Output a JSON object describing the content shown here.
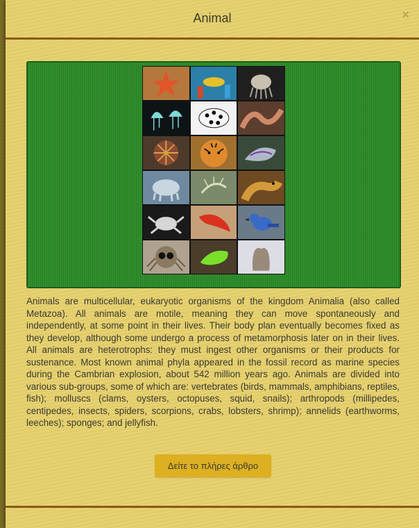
{
  "modal": {
    "title": "Animal",
    "close_label": "×"
  },
  "image": {
    "alt": "Animal diversity collage",
    "tiles": [
      {
        "subject": "starfish",
        "color": "#b5773c"
      },
      {
        "subject": "reef-fish",
        "color": "#2c7fa8"
      },
      {
        "subject": "cuttlefish",
        "color": "#1f1f1f"
      },
      {
        "subject": "jellyfish",
        "color": "#0e1416"
      },
      {
        "subject": "spotted-beetle",
        "color": "#f2f2f2"
      },
      {
        "subject": "worm",
        "color": "#5b3e2e"
      },
      {
        "subject": "tube-worm",
        "color": "#4d3a2b"
      },
      {
        "subject": "tiger",
        "color": "#a0702f"
      },
      {
        "subject": "sea-slug",
        "color": "#3a4a3a"
      },
      {
        "subject": "tardigrade",
        "color": "#6f8aa0"
      },
      {
        "subject": "shrimp-larva",
        "color": "#7a8a6a"
      },
      {
        "subject": "moray-eel",
        "color": "#6d4a22"
      },
      {
        "subject": "crab",
        "color": "#1a1a1a"
      },
      {
        "subject": "flatworm",
        "color": "#c6a078"
      },
      {
        "subject": "blue-jay",
        "color": "#6a7a88"
      },
      {
        "subject": "jumping-spider",
        "color": "#b0a290"
      },
      {
        "subject": "green-slug",
        "color": "#4a3d2a"
      },
      {
        "subject": "sponge",
        "color": "#dddde6"
      }
    ]
  },
  "description": "Animals are multicellular, eukaryotic organisms of the kingdom Animalia (also called Metazoa). All animals are motile, meaning they can move spontaneously and independently, at some point in their lives. Their body plan eventually becomes fixed as they develop, although some undergo a process of metamorphosis later on in their lives. All animals are heterotrophs: they must ingest other organisms or their products for sustenance. Most known animal phyla appeared in the fossil record as marine species during the Cambrian explosion, about 542 million years ago. Animals are divided into various sub-groups, some of which are: vertebrates (birds, mammals, amphibians, reptiles, fish); molluscs (clams, oysters, octopuses, squid, snails); arthropods (millipedes, centipedes, insects, spiders, scorpions, crabs, lobsters, shrimp); annelids (earthworms, leeches); sponges; and jellyfish.",
  "button": {
    "label": "Δείτε το πλήρες άρθρο"
  },
  "colors": {
    "modal_background": "#e6d06c",
    "rule": "#8a5a12",
    "image_panel": "#2a8a26",
    "button": "#dcb021"
  }
}
